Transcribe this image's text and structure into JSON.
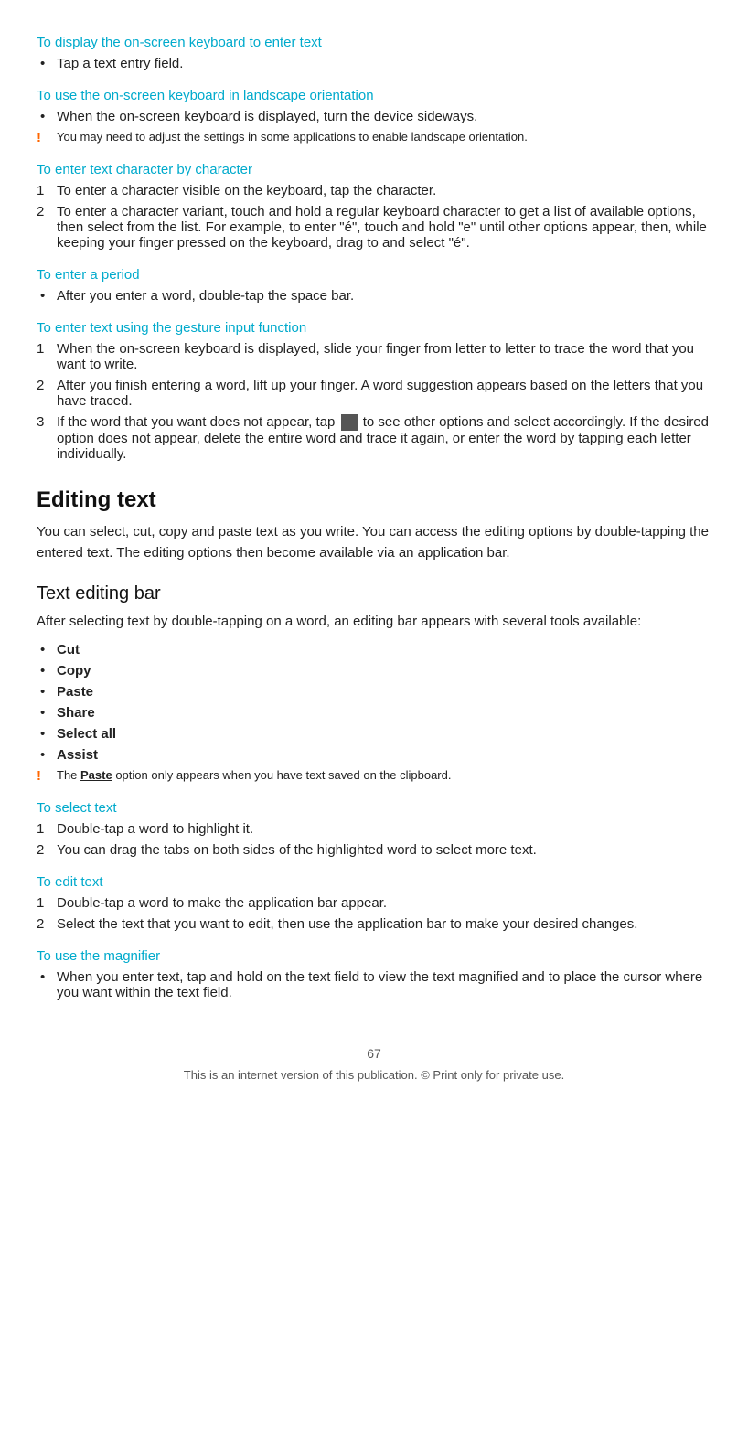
{
  "sections": {
    "display_keyboard_heading": "To display the on-screen keyboard to enter text",
    "display_keyboard_bullet": "Tap a text entry field.",
    "landscape_keyboard_heading": "To use the on-screen keyboard in landscape orientation",
    "landscape_keyboard_bullet": "When the on-screen keyboard is displayed, turn the device sideways.",
    "landscape_keyboard_warn": "You may need to adjust the settings in some applications to enable landscape orientation.",
    "enter_char_heading": "To enter text character by character",
    "enter_char_1": "To enter a character visible on the keyboard, tap the character.",
    "enter_char_2": "To enter a character variant, touch and hold a regular keyboard character to get a list of available options, then select from the list. For example, to enter \"é\", touch and hold \"e\" until other options appear, then, while keeping your finger pressed on the keyboard, drag to and select \"é\".",
    "enter_period_heading": "To enter a period",
    "enter_period_bullet": "After you enter a word, double-tap the space bar.",
    "gesture_heading": "To enter text using the gesture input function",
    "gesture_1": "When the on-screen keyboard is displayed, slide your finger from letter to letter to trace the word that you want to write.",
    "gesture_2": "After you finish entering a word, lift up your finger. A word suggestion appears based on the letters that you have traced.",
    "gesture_3_pre": "If the word that you want does not appear, tap ",
    "gesture_3_post": " to see other options and select accordingly. If the desired option does not appear, delete the entire word and trace it again, or enter the word by tapping each letter individually.",
    "editing_text_h2": "Editing text",
    "editing_text_para": "You can select, cut, copy and paste text as you write. You can access the editing options by double-tapping the entered text. The editing options then become available via an application bar.",
    "text_editing_bar_h3": "Text editing bar",
    "text_editing_bar_para": "After selecting text by double-tapping on a word, an editing bar appears with several tools available:",
    "tools": [
      "Cut",
      "Copy",
      "Paste",
      "Share",
      "Select all",
      "Assist"
    ],
    "paste_warn_pre": "The ",
    "paste_warn_bold": "Paste",
    "paste_warn_post": " option only appears when you have text saved on the clipboard.",
    "select_text_heading": "To select text",
    "select_text_1": "Double-tap a word to highlight it.",
    "select_text_2": "You can drag the tabs on both sides of the highlighted word to select more text.",
    "edit_text_heading": "To edit text",
    "edit_text_1": "Double-tap a word to make the application bar appear.",
    "edit_text_2": "Select the text that you want to edit, then use the application bar to make your desired changes.",
    "magnifier_heading": "To use the magnifier",
    "magnifier_bullet": "When you enter text, tap and hold on the text field to view the text magnified and to place the cursor where you want within the text field.",
    "page_number": "67",
    "footer_text": "This is an internet version of this publication. © Print only for private use."
  }
}
